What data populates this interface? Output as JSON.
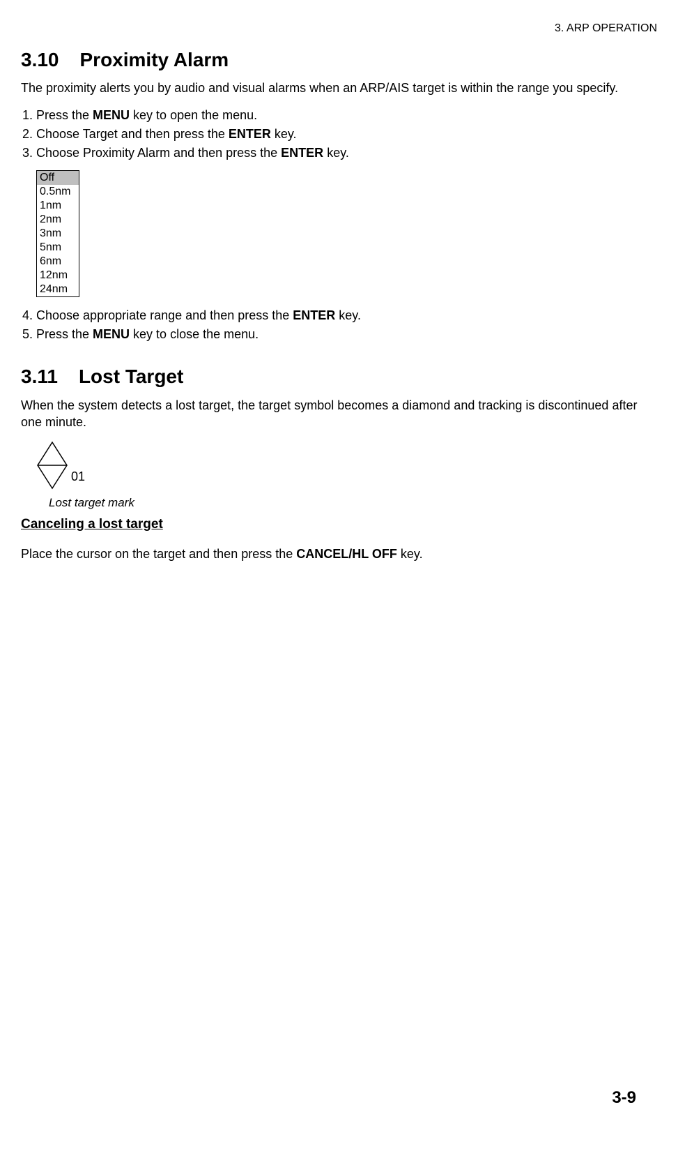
{
  "header": {
    "chapter": "3. ARP OPERATION"
  },
  "section310": {
    "number": "3.10",
    "title": "Proximity Alarm",
    "intro": "The proximity alerts you by audio and visual alarms when an ARP/AIS target is within the range you specify.",
    "step1_pre": "Press the ",
    "step1_bold": "MENU",
    "step1_post": " key to open the menu.",
    "step2_pre": "Choose Target and then press the ",
    "step2_bold": "ENTER",
    "step2_post": " key.",
    "step3_pre": "Choose Proximity Alarm and then press the ",
    "step3_bold": "ENTER",
    "step3_post": " key.",
    "options": [
      "Off",
      "0.5nm",
      "1nm",
      "2nm",
      "3nm",
      "5nm",
      "6nm",
      "12nm",
      "24nm"
    ],
    "step4_pre": "Choose appropriate range and then press the ",
    "step4_bold": "ENTER",
    "step4_post": " key.",
    "step5_pre": "Press the ",
    "step5_bold": "MENU",
    "step5_post": " key to close the menu."
  },
  "section311": {
    "number": "3.11",
    "title": "Lost Target",
    "intro": "When the system detects a lost target, the target symbol becomes a diamond and tracking is discontinued after one minute.",
    "diamond_label": "01",
    "figure_caption": "Lost target mark",
    "subhead": "Canceling a lost target",
    "body_pre": "Place the cursor on the target and then press the ",
    "body_bold": "CANCEL/HL OFF",
    "body_post": " key."
  },
  "footer": {
    "page": "3-9"
  }
}
